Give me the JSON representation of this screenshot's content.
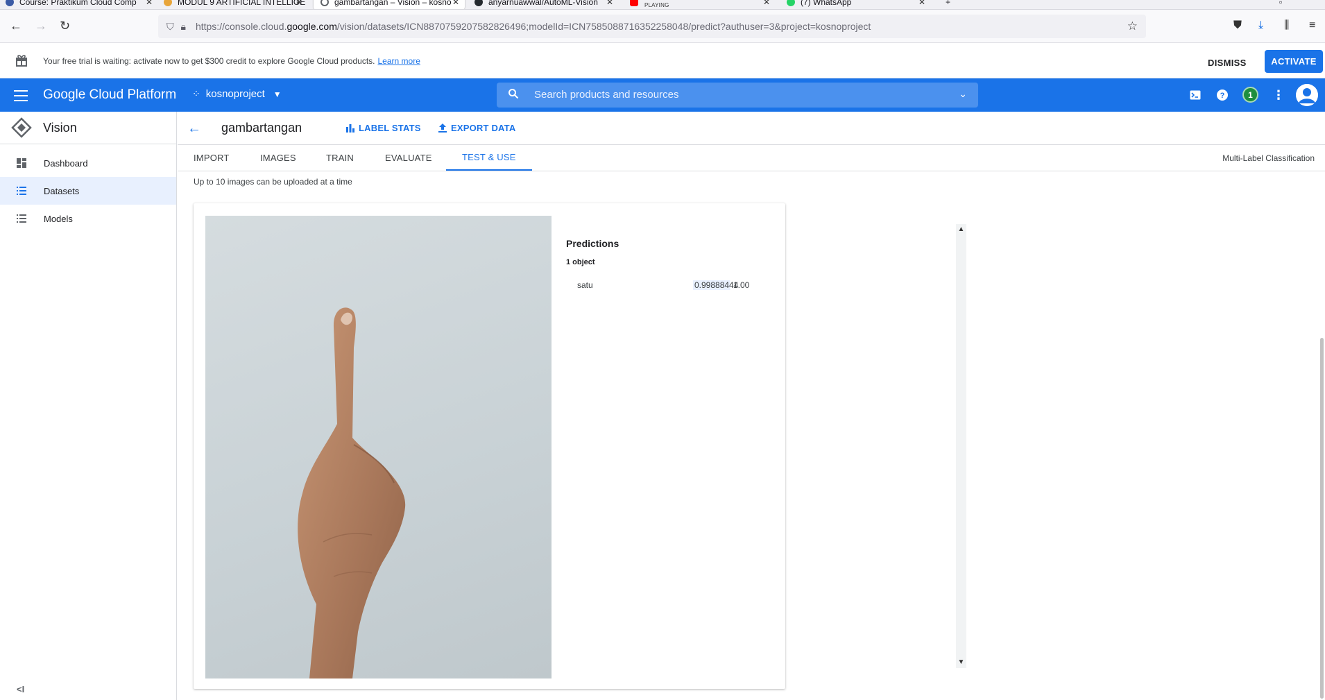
{
  "browser": {
    "tabs": [
      {
        "label": "Course: Praktikum Cloud Comp",
        "active": false
      },
      {
        "label": "MODUL 9 ARTIFICIAL INTELLIGE",
        "active": false
      },
      {
        "label": "gambartangan – Vision – kosno",
        "active": true
      },
      {
        "label": "anyarnuawwal/AutoML-Vision",
        "active": false
      },
      {
        "label": "PLAYING",
        "active": false
      },
      {
        "label": "(7) WhatsApp",
        "active": false
      }
    ],
    "url_prefix": "https://console.cloud.",
    "url_domain": "google.com",
    "url_suffix": "/vision/datasets/ICN8870759207582826496;modelId=ICN7585088716352258048/predict?authuser=3&project=kosnoproject"
  },
  "banner": {
    "text": "Your free trial is waiting: activate now to get $300 credit to explore Google Cloud products.",
    "link": "Learn more",
    "dismiss": "DISMISS",
    "activate": "ACTIVATE"
  },
  "header": {
    "title": "Google Cloud Platform",
    "project": "kosnoproject",
    "search_placeholder": "Search products and resources",
    "notification_count": "1"
  },
  "sidebar": {
    "product": "Vision",
    "items": [
      {
        "label": "Dashboard",
        "icon": "dashboard-icon"
      },
      {
        "label": "Datasets",
        "icon": "list-icon",
        "active": true
      },
      {
        "label": "Models",
        "icon": "list-icon"
      }
    ],
    "collapse": "<I"
  },
  "content": {
    "dataset_name": "gambartangan",
    "label_stats": "LABEL STATS",
    "export_data": "EXPORT DATA",
    "tabs": [
      "IMPORT",
      "IMAGES",
      "TRAIN",
      "EVALUATE",
      "TEST & USE"
    ],
    "active_tab": "TEST & USE",
    "classification_type": "Multi-Label Classification",
    "upload_hint": "Up to 10 images can be uploaded at a time"
  },
  "predictions": {
    "title": "Predictions",
    "count": "1 object",
    "rows": [
      {
        "label": "satu",
        "score": "0.99888444",
        "max": "1.00"
      }
    ]
  },
  "colors": {
    "brand_blue": "#1a73e8",
    "notification_green": "#1e8e3e"
  }
}
